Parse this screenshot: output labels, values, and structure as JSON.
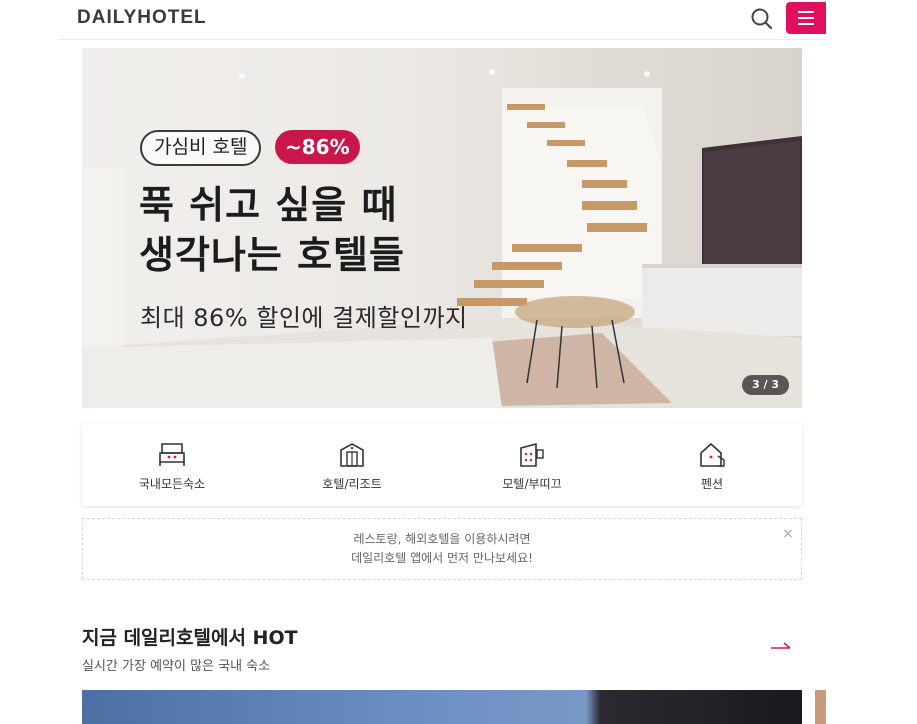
{
  "header": {
    "logo": "DAILYHOTEL",
    "search_icon": "search-icon",
    "menu_icon": "hamburger-menu-icon",
    "accent": "#e0105f"
  },
  "banner": {
    "tag": "가심비 호텔",
    "discount": "~86%",
    "title_line1": "푹 쉬고 싶을 때",
    "title_line2": "생각나는 호텔들",
    "subtitle": "최대 86% 할인에 결제할인까지",
    "pager": "3 / 3"
  },
  "categories": [
    {
      "label": "국내모든숙소",
      "icon": "bed-icon"
    },
    {
      "label": "호텔/리조트",
      "icon": "hotel-building-icon"
    },
    {
      "label": "모텔/부띠끄",
      "icon": "motel-building-icon"
    },
    {
      "label": "펜션",
      "icon": "pension-house-icon"
    }
  ],
  "notice": {
    "line1": "레스토랑, 해외호텔을 이용하시려면",
    "line2": "데일리호텔 앱에서 먼저 만나보세요!",
    "close": "×"
  },
  "section": {
    "title": "지금 데일리호텔에서 HOT",
    "subtitle": "실시간 가장 예약이 많은 국내 숙소",
    "arrow_icon": "arrow-right-icon"
  }
}
